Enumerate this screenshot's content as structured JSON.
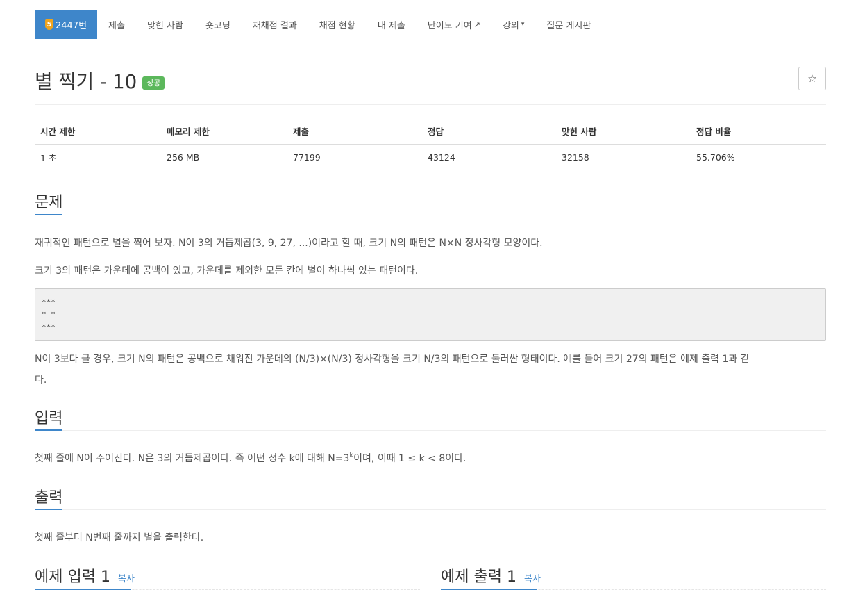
{
  "nav": {
    "problem_number": "2447번",
    "tier_badge": "5",
    "items": [
      "제출",
      "맞힌 사람",
      "숏코딩",
      "재채점 결과",
      "채점 현황",
      "내 제출",
      "난이도 기여",
      "강의",
      "질문 게시판"
    ]
  },
  "title": "별 찍기 - 10",
  "result_badge": "성공",
  "star_icon": "☆",
  "info": {
    "headers": [
      "시간 제한",
      "메모리 제한",
      "제출",
      "정답",
      "맞힌 사람",
      "정답 비율"
    ],
    "values": [
      "1 초",
      "256 MB",
      "77199",
      "43124",
      "32158",
      "55.706%"
    ]
  },
  "problem": {
    "heading": "문제",
    "p1": "재귀적인 패턴으로 별을 찍어 보자. N이 3의 거듭제곱(3, 9, 27, ...)이라고 할 때, 크기 N의 패턴은 N×N 정사각형 모양이다.",
    "p2": "크기 3의 패턴은 가운데에 공백이 있고, 가운데를 제외한 모든 칸에 별이 하나씩 있는 패턴이다.",
    "pattern": [
      "***",
      "* *",
      "***"
    ],
    "p3_line1": "N이 3보다 클 경우, 크기 N의 패턴은 공백으로 채워진 가운데의 (N/3)×(N/3) 정사각형을 크기 N/3의 패턴으로 둘러싼 형태이다. 예를 들어 크기 27의 패턴은 예제 출력 1과 같",
    "p3_line2": "다."
  },
  "input": {
    "heading": "입력",
    "text_before": "첫째 줄에 N이 주어진다. N은 3의 거듭제곱이다. 즉 어떤 정수 k에 대해 N=3",
    "superscript": "k",
    "text_after": "이며, 이때 1 ≤ k < 8이다."
  },
  "output": {
    "heading": "출력",
    "text": "첫째 줄부터 N번째 줄까지 별을 출력한다."
  },
  "samples": {
    "input_title": "예제 입력 1",
    "output_title": "예제 출력 1",
    "copy_label": "복사"
  },
  "colors": {
    "accent": "#3e86ca",
    "success": "#5cb85c",
    "tier": "#f0a41c"
  }
}
